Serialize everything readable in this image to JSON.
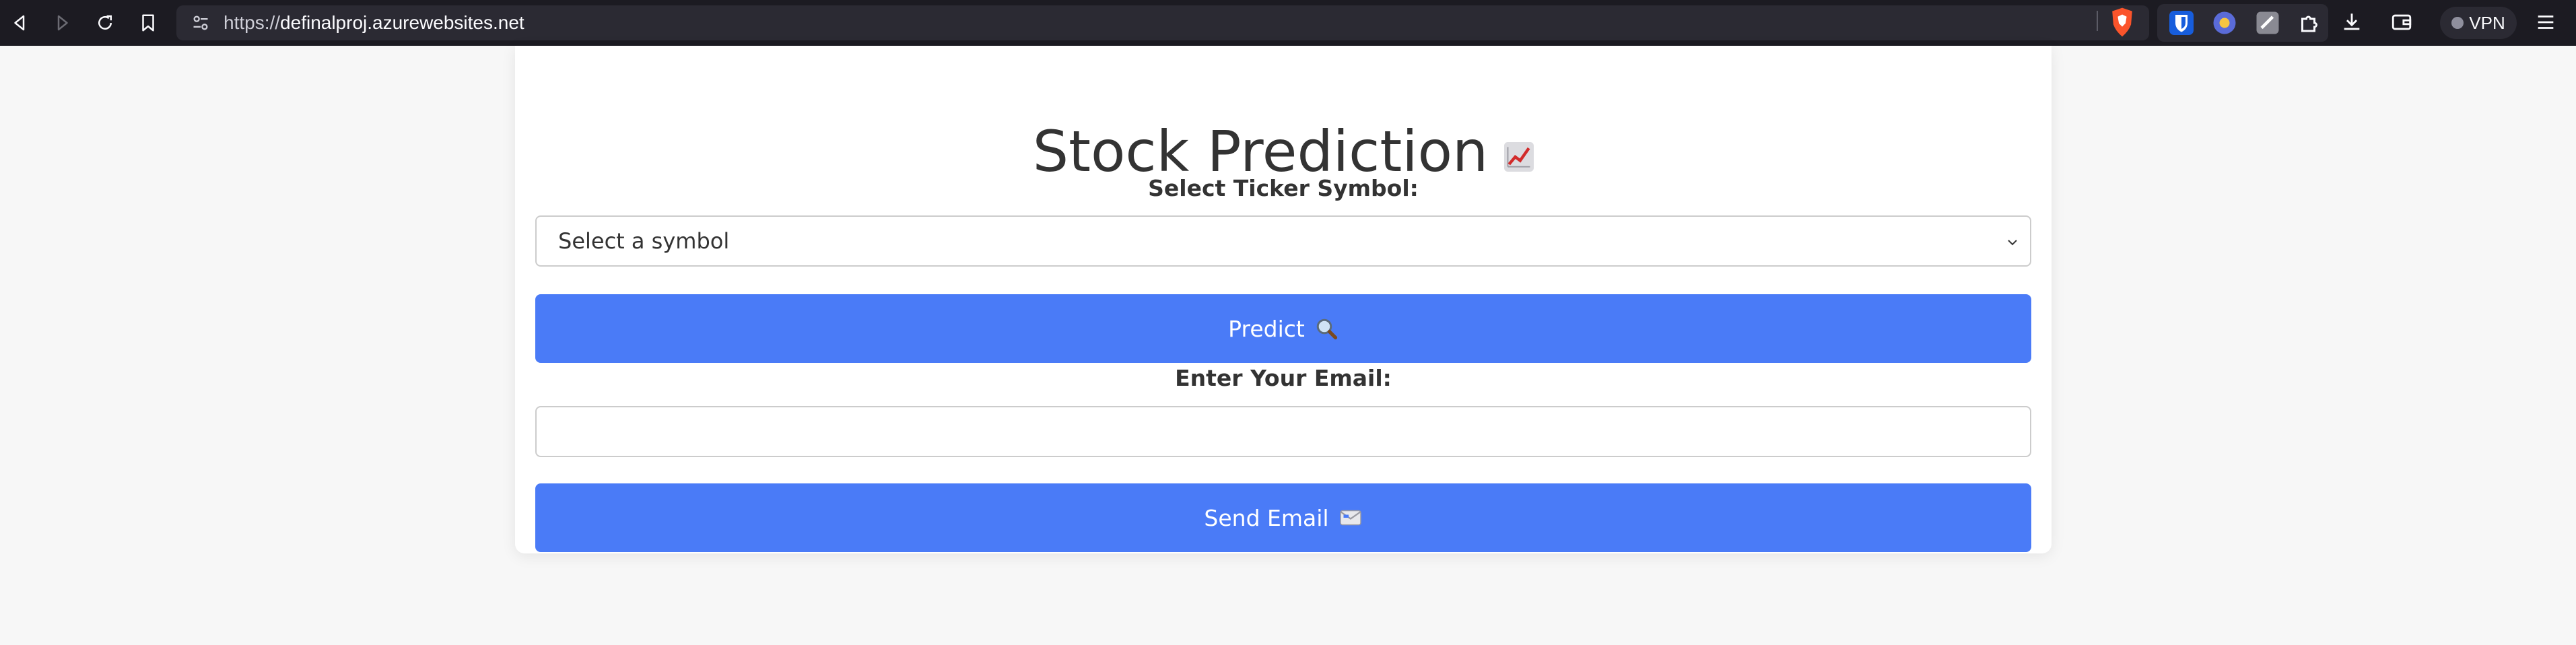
{
  "browser": {
    "url_scheme": "https://",
    "url_host": "definalproj.azurewebsites.net",
    "vpn_label": "VPN"
  },
  "page": {
    "title": "Stock Prediction",
    "title_icon": "chart-increasing-icon",
    "ticker_label": "Select Ticker Symbol:",
    "ticker_select": {
      "selected": "Select a symbol",
      "options": [
        "Select a symbol"
      ]
    },
    "predict_button": "Predict",
    "predict_icon": "magnifier-icon",
    "email_label": "Enter Your Email:",
    "email_value": "",
    "send_button": "Send Email",
    "send_icon": "email-icon"
  },
  "colors": {
    "accent": "#4a7bf7",
    "background": "#f7f7f7",
    "toolbar": "#1c1b22"
  }
}
